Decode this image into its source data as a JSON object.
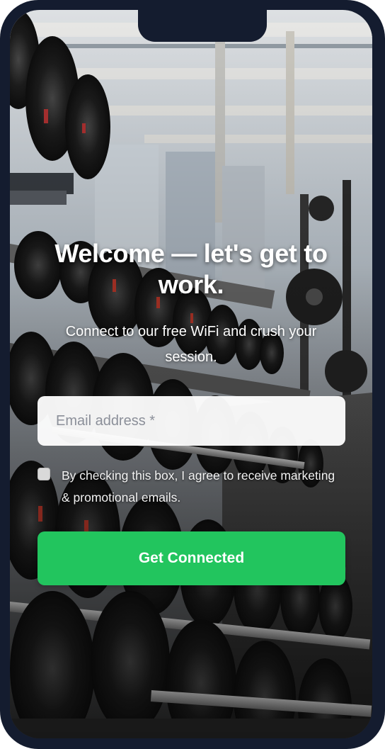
{
  "hero": {
    "title": "Welcome — let's get to work.",
    "subtitle": "Connect to our free WiFi and crush your session."
  },
  "form": {
    "email_placeholder": "Email address *",
    "email_value": "",
    "consent_checked": false,
    "consent_label": "By checking this box, I agree to receive marketing & promotional emails.",
    "submit_label": "Get Connected"
  },
  "colors": {
    "frame": "#141c2f",
    "button": "#22c55e",
    "button_text": "#ffffff"
  }
}
